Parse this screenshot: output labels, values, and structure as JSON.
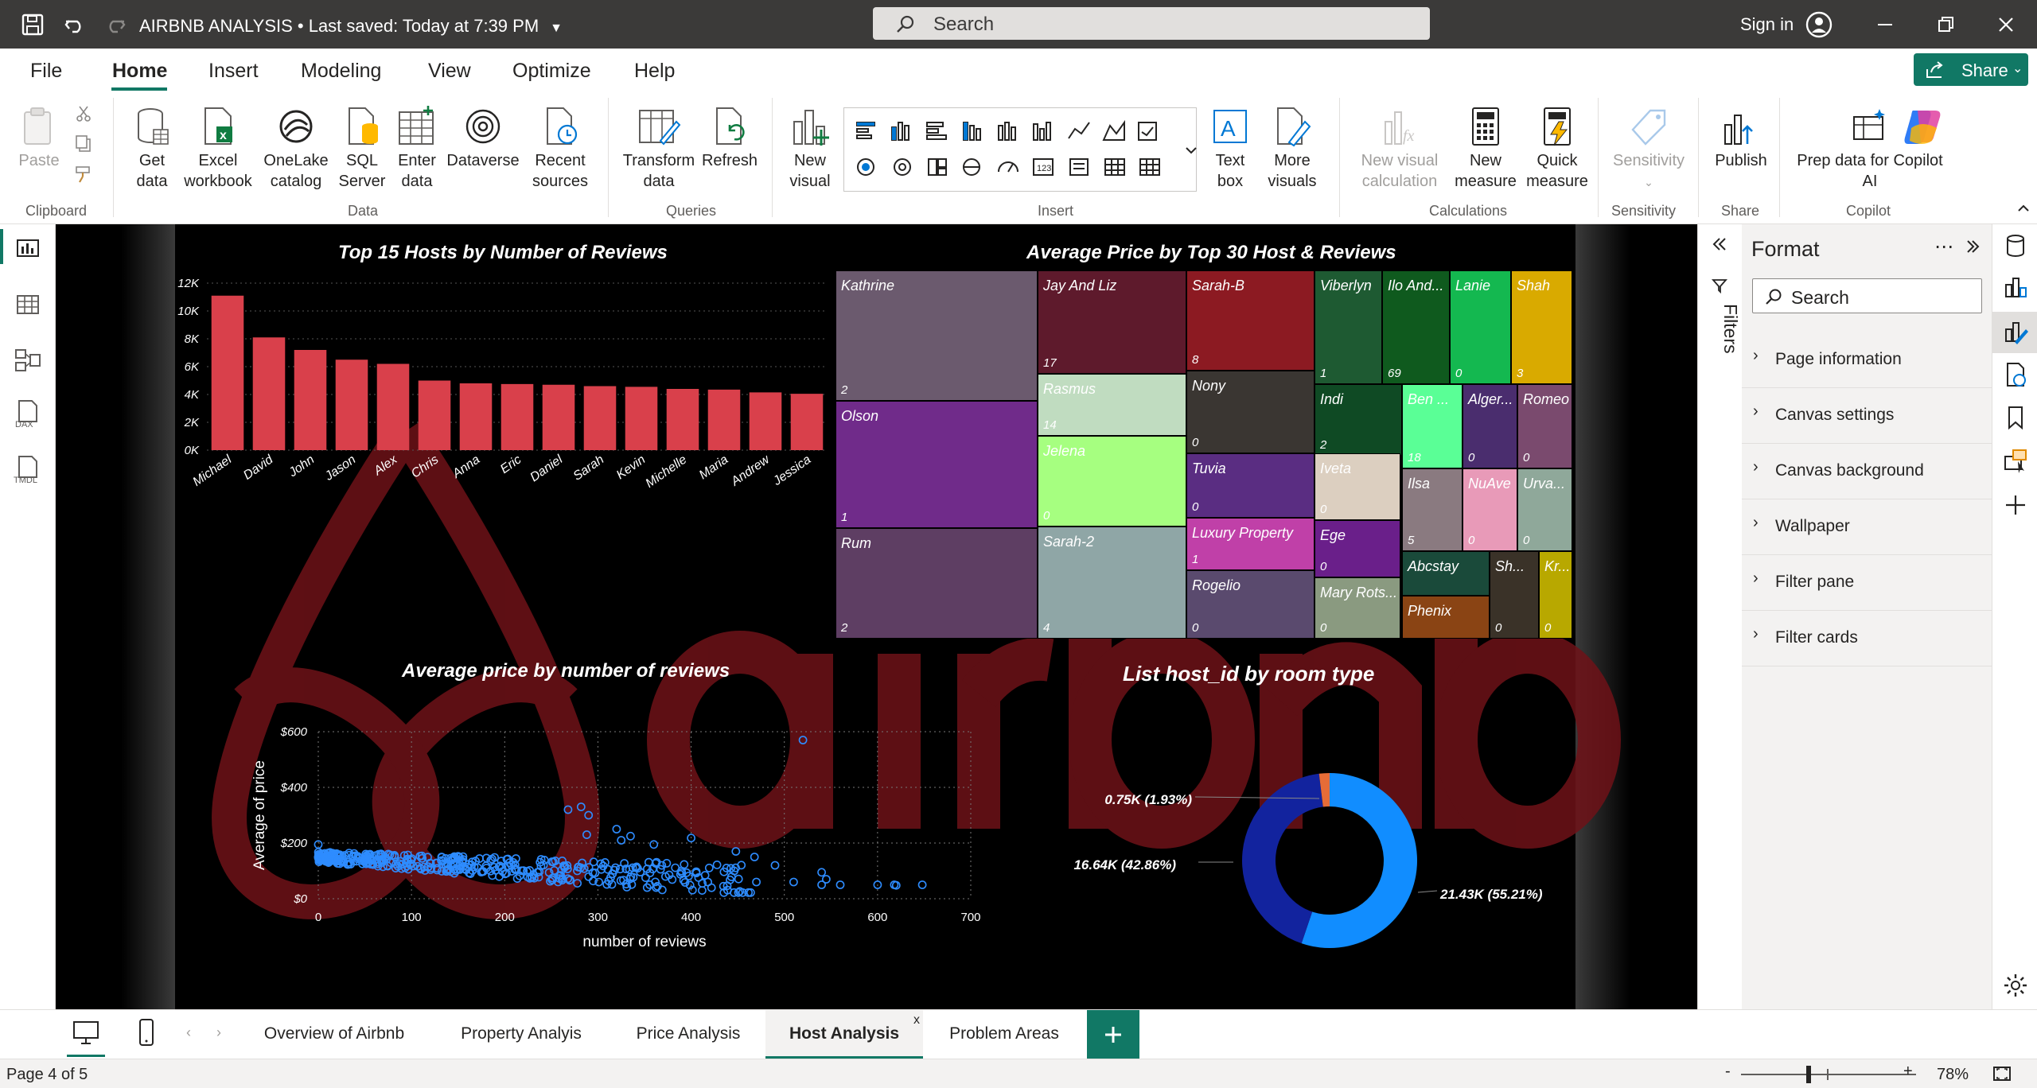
{
  "titlebar": {
    "doc_title": "AIRBNB ANALYSIS",
    "saved": " • Last saved: Today at 7:39 PM",
    "search_placeholder": "Search",
    "signin": "Sign in"
  },
  "menu": {
    "items": [
      "File",
      "Home",
      "Insert",
      "Modeling",
      "View",
      "Optimize",
      "Help"
    ],
    "active": "Home",
    "share": "Share"
  },
  "ribbon": {
    "paste": "Paste",
    "get_data": "Get data",
    "excel": "Excel workbook",
    "onelake": "OneLake catalog",
    "sql": "SQL Server",
    "enter_data": "Enter data",
    "dataverse": "Dataverse",
    "recent": "Recent sources",
    "transform": "Transform data",
    "refresh": "Refresh",
    "new_visual": "New visual",
    "text_box": "Text box",
    "more_visuals": "More visuals",
    "new_visual_calc": "New visual calculation",
    "new_measure": "New measure",
    "quick_measure": "Quick measure",
    "sensitivity": "Sensitivity",
    "publish": "Publish",
    "copilot": "Prep data for Copilot AI",
    "groups": {
      "clipboard": "Clipboard",
      "data": "Data",
      "queries": "Queries",
      "insert": "Insert",
      "calculations": "Calculations",
      "sensitivity": "Sensitivity",
      "share": "Share",
      "copilot": "Copilot"
    }
  },
  "leftnav": {
    "dax": "DAX",
    "tmdl": "TMDL"
  },
  "report": {
    "bar_title": "Top 15 Hosts by Number of Reviews",
    "treemap_title": "Average Price by Top 30 Host & Reviews",
    "scatter_title": "Average price by number of reviews",
    "donut_title": "List host_id by room type",
    "accent": "#d9404b"
  },
  "chart_data": [
    {
      "type": "bar",
      "title": "Top 15 Hosts by Number of Reviews",
      "categories": [
        "Michael",
        "David",
        "John",
        "Jason",
        "Alex",
        "Chris",
        "Anna",
        "Eric",
        "Daniel",
        "Sarah",
        "Kevin",
        "Michelle",
        "Maria",
        "Andrew",
        "Jessica"
      ],
      "values": [
        11100,
        8100,
        7200,
        6500,
        6200,
        5000,
        4800,
        4750,
        4700,
        4600,
        4550,
        4400,
        4350,
        4150,
        4050
      ],
      "yticks": [
        "0K",
        "2K",
        "4K",
        "6K",
        "8K",
        "10K",
        "12K"
      ],
      "ylim": [
        0,
        12000
      ],
      "color": "#d9404b"
    },
    {
      "type": "treemap",
      "title": "Average Price by Top 30 Host & Reviews",
      "items": [
        {
          "name": "Kathrine",
          "value": "2",
          "color": "#6b5a6e"
        },
        {
          "name": "Olson",
          "value": "1",
          "color": "#702b8a"
        },
        {
          "name": "Rum",
          "value": "2",
          "color": "#5e3e63"
        },
        {
          "name": "Jay And Liz",
          "value": "17",
          "color": "#5e1a2c"
        },
        {
          "name": "Rasmus",
          "value": "14",
          "color": "#c0dcc0"
        },
        {
          "name": "Jelena",
          "value": "0",
          "color": "#a6ff80"
        },
        {
          "name": "Sarah-2",
          "value": "4",
          "color": "#8fa6a6"
        },
        {
          "name": "Sarah-B",
          "value": "8",
          "color": "#8c1a22"
        },
        {
          "name": "Nony",
          "value": "0",
          "color": "#3a3632"
        },
        {
          "name": "Tuvia",
          "value": "0",
          "color": "#5a2d82"
        },
        {
          "name": "Luxury Property",
          "value": "1",
          "color": "#c040a8"
        },
        {
          "name": "Rogelio",
          "value": "0",
          "color": "#5a4a6e"
        },
        {
          "name": "Viberlyn",
          "value": "1",
          "color": "#1e5a32"
        },
        {
          "name": "Ilo And...",
          "value": "69",
          "color": "#0f5a1e"
        },
        {
          "name": "Lanie",
          "value": "0",
          "color": "#14b850"
        },
        {
          "name": "Shah",
          "value": "3",
          "color": "#d9aa00"
        },
        {
          "name": "Indi",
          "value": "2",
          "color": "#0f4a24"
        },
        {
          "name": "Ben ...",
          "value": "18",
          "color": "#5aff96"
        },
        {
          "name": "Alger...",
          "value": "0",
          "color": "#4a2d6e"
        },
        {
          "name": "Romeo",
          "value": "0",
          "color": "#7a4a6e"
        },
        {
          "name": "Iveta",
          "value": "0",
          "color": "#dccfc0"
        },
        {
          "name": "Ilsa",
          "value": "5",
          "color": "#8a7a80"
        },
        {
          "name": "NuAve",
          "value": "0",
          "color": "#e89ab8"
        },
        {
          "name": "Urva...",
          "value": "0",
          "color": "#8fa89a"
        },
        {
          "name": "Ege",
          "value": "0",
          "color": "#6a1f8a"
        },
        {
          "name": "Abcstay",
          "value": "",
          "color": "#1a4a3a"
        },
        {
          "name": "Phenix",
          "value": "",
          "color": "#8a4414"
        },
        {
          "name": "Sh...",
          "value": "0",
          "color": "#3a3228"
        },
        {
          "name": "Kr...",
          "value": "0",
          "color": "#b8a800"
        },
        {
          "name": "Mary Rots...",
          "value": "0",
          "color": "#8a9a80"
        }
      ]
    },
    {
      "type": "scatter",
      "title": "Average price by number of reviews",
      "xlabel": "number of reviews",
      "ylabel": "Average of price",
      "xticks": [
        "0",
        "100",
        "200",
        "300",
        "400",
        "500",
        "600",
        "700"
      ],
      "yticks": [
        "$0",
        "$200",
        "$400",
        "$600"
      ],
      "xlim": [
        0,
        700
      ],
      "ylim": [
        0,
        600
      ],
      "color": "#2e8cff"
    },
    {
      "type": "pie",
      "title": "List host_id by room type",
      "slices": [
        {
          "label": "21.43K (55.21%)",
          "value": 21.43,
          "color": "#118dff"
        },
        {
          "label": "16.64K (42.86%)",
          "value": 16.64,
          "color": "#12239e"
        },
        {
          "label": "0.75K (1.93%)",
          "value": 0.75,
          "color": "#e66c37"
        }
      ]
    }
  ],
  "filters": {
    "label": "Filters"
  },
  "format_pane": {
    "title": "Format",
    "search_placeholder": "Search",
    "sections": [
      "Page information",
      "Canvas settings",
      "Canvas background",
      "Wallpaper",
      "Filter pane",
      "Filter cards"
    ]
  },
  "tabs": {
    "items": [
      "Overview of Airbnb",
      "Property Analyis",
      "Price Analysis",
      "Host Analysis",
      "Problem Areas"
    ],
    "active": "Host Analysis"
  },
  "status": {
    "page": "Page 4 of 5",
    "zoom": "78%"
  }
}
